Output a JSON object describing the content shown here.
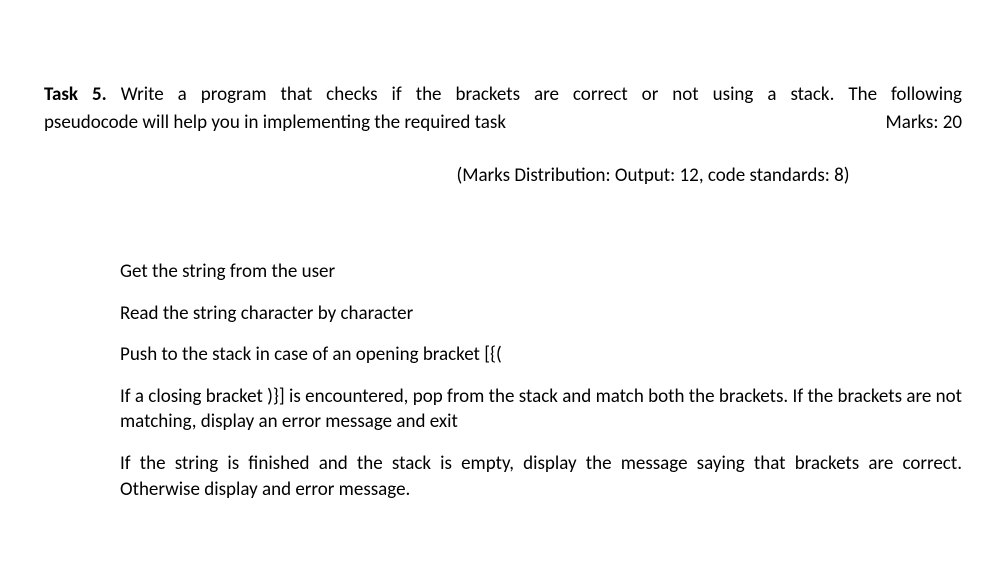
{
  "task": {
    "label": "Task 5.",
    "description_line1": "Write a program that checks if the brackets are correct or not using a stack. The following",
    "description_line2": "pseudocode will help you in implementing the required task",
    "marks": "Marks: 20",
    "marks_distribution": "(Marks Distribution: Output: 12, code standards: 8)"
  },
  "pseudocode": {
    "step1": "Get the string from the user",
    "step2": "Read the string character by character",
    "step3": "Push to the stack in case of an opening bracket [{(",
    "step4": "If a closing bracket )}] is encountered, pop from the stack and match both the brackets. If the brackets are not matching, display an error message and exit",
    "step5": "If the string is finished and the stack is empty, display the message saying that brackets are correct. Otherwise display and error message."
  }
}
